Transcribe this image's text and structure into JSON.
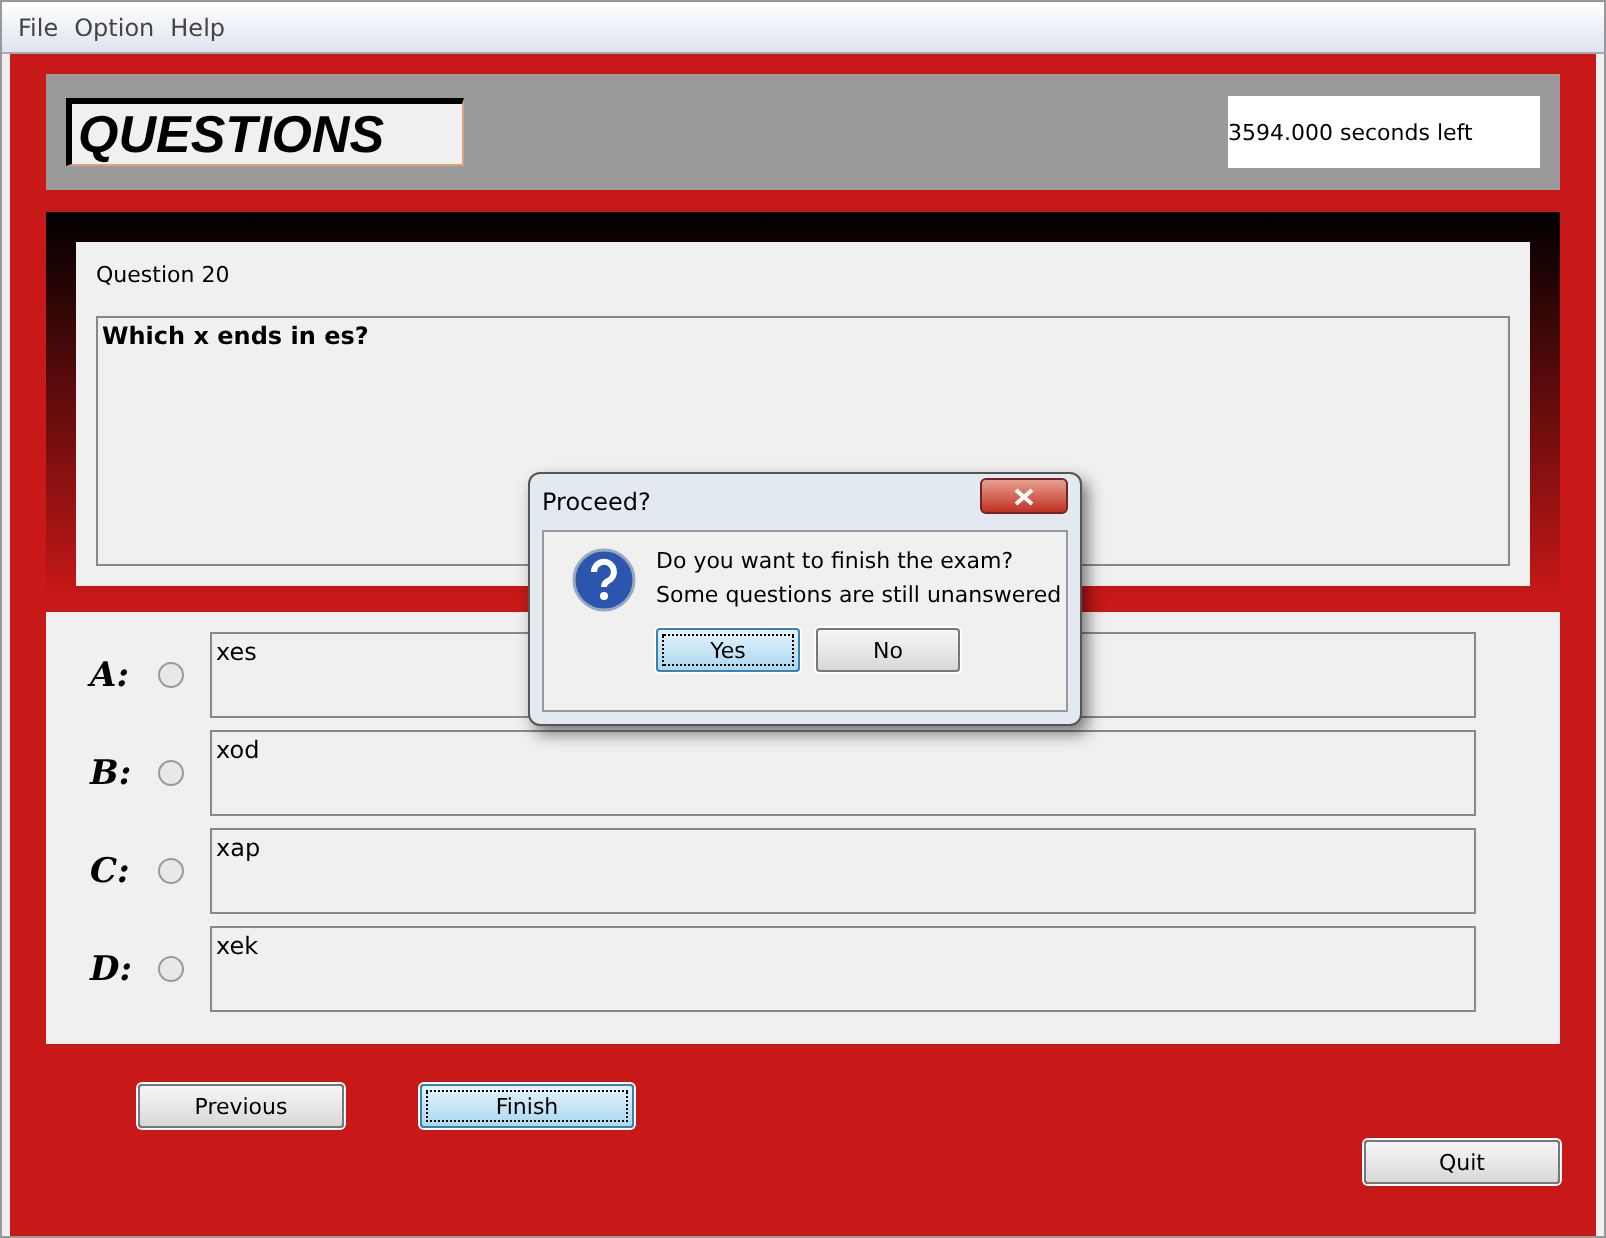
{
  "menu": [
    "File",
    "Option",
    "Help"
  ],
  "header": {
    "title": "QUESTIONS",
    "timer": "3594.000 seconds left"
  },
  "question": {
    "number": "Question 20",
    "text": "Which x ends in es?"
  },
  "answers": [
    {
      "letter": "A:",
      "text": "xes",
      "selected": false
    },
    {
      "letter": "B:",
      "text": "xod",
      "selected": false
    },
    {
      "letter": "C:",
      "text": "xap",
      "selected": false
    },
    {
      "letter": "D:",
      "text": "xek",
      "selected": false
    }
  ],
  "nav_buttons": [
    {
      "label": "Previous",
      "focused": false
    },
    {
      "label": "Finish",
      "focused": true
    }
  ],
  "quit_button": {
    "label": "Quit",
    "focused": false
  },
  "dialog": {
    "title": "Proceed?",
    "message": "Do you want to finish the exam?",
    "detail": "Some questions are still unanswered",
    "buttons": [
      {
        "label": "Yes",
        "focused": true
      },
      {
        "label": "No",
        "focused": false
      }
    ]
  }
}
